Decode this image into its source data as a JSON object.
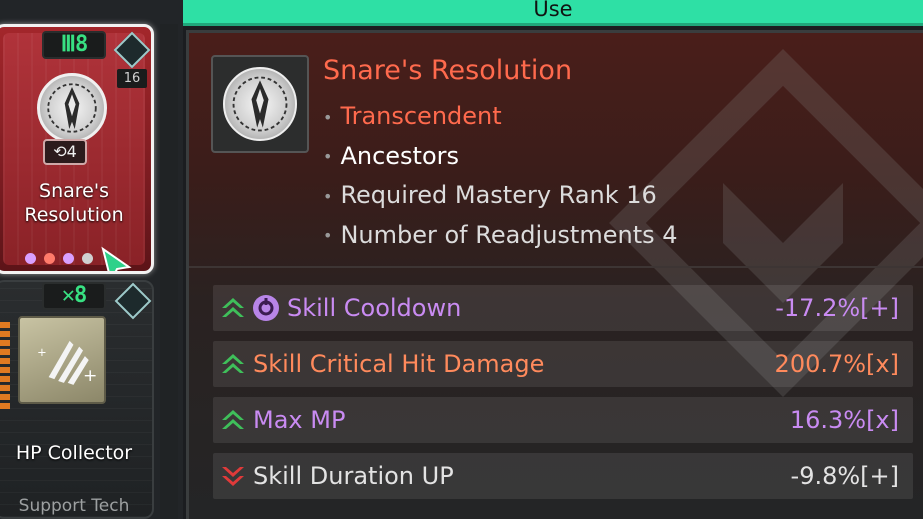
{
  "use_bar": {
    "label": "Use"
  },
  "cards": [
    {
      "rank": "8",
      "level": "16",
      "readjustments": "4",
      "name_line1": "Snare's",
      "name_line2": "Resolution",
      "socket_colors": [
        "#d9a0ff",
        "#ff7b6b",
        "#d9a0ff",
        "#d0d0d0"
      ]
    },
    {
      "rank": "8",
      "name": "HP Collector",
      "type": "Support Tech"
    }
  ],
  "detail": {
    "title": "Snare's Resolution",
    "grade": "Transcendent",
    "family": "Ancestors",
    "required": "Required Mastery Rank 16",
    "readjust": "Number of Readjustments 4",
    "stats": [
      {
        "name": "Skill Cooldown",
        "value": "-17.2%[+]",
        "trend": "up",
        "color": "purple",
        "has_icon": true
      },
      {
        "name": "Skill Critical Hit Damage",
        "value": "200.7%[x]",
        "trend": "up",
        "color": "orange",
        "has_icon": false
      },
      {
        "name": "Max MP",
        "value": "16.3%[x]",
        "trend": "up",
        "color": "purple",
        "has_icon": false
      },
      {
        "name": "Skill Duration UP",
        "value": "-9.8%[+]",
        "trend": "down",
        "color": "white",
        "has_icon": false
      }
    ]
  },
  "colors": {
    "accent_green": "#2ee0a5",
    "up_arrow": "#3fbf5a",
    "down_arrow": "#e03a3a",
    "grade_orange": "#ff6a4d",
    "purple": "#c98bf2"
  }
}
